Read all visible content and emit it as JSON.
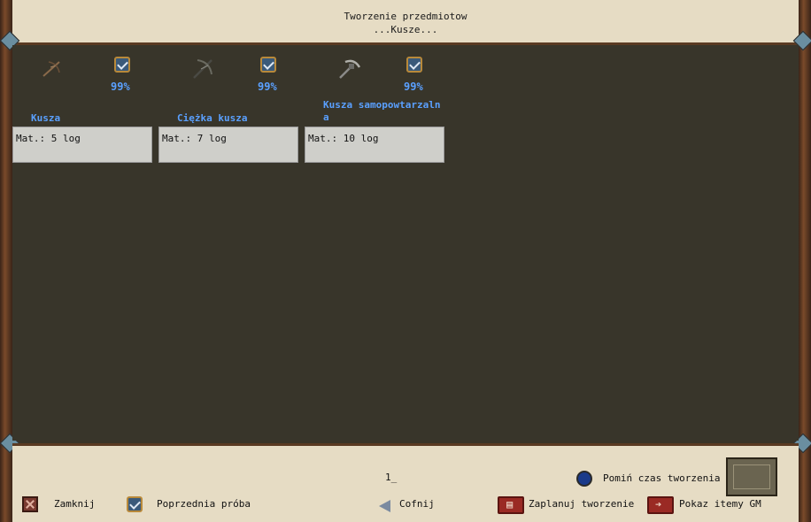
{
  "header": {
    "title": "Tworzenie przedmiotow",
    "subtitle": "...Kusze..."
  },
  "items": [
    {
      "name": "Kusza",
      "chance": "99%",
      "material": "Mat.: 5 log",
      "icon": "crossbow-icon"
    },
    {
      "name": "Ciężka kusza",
      "chance": "99%",
      "material": "Mat.: 7 log",
      "icon": "heavy-crossbow-icon"
    },
    {
      "name_line1": "Kusza samopowtarzaln",
      "name_line2": "a",
      "chance": "99%",
      "material": "Mat.: 10 log",
      "icon": "repeating-crossbow-icon"
    }
  ],
  "footer": {
    "page": "1_",
    "close": "Zamknij",
    "previous": "Poprzednia próba",
    "back": "Cofnij",
    "plan": "Zaplanuj tworzenie",
    "show_gm": "Pokaz itemy GM",
    "skip_time": "Pomiń czas tworzenia"
  },
  "colors": {
    "accent": "#5aa0ff",
    "parchment": "#e6dcc4",
    "panel": "#38352a"
  }
}
